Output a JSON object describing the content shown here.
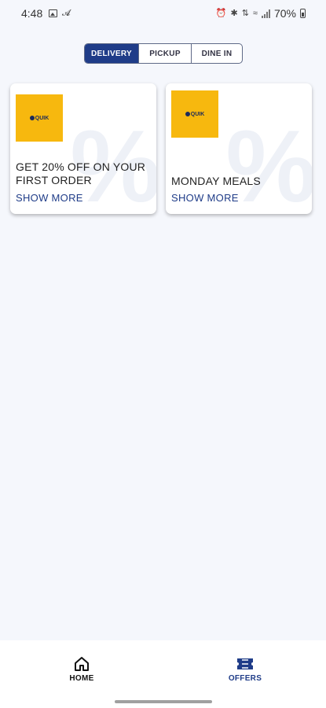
{
  "status_bar": {
    "time": "4:48",
    "battery": "70%",
    "left_icons": [
      "image-icon",
      "signal-badge-icon"
    ],
    "right_icons": [
      "alarm-icon",
      "bluetooth-icon",
      "data-icon",
      "wifi-icon",
      "signal-icon",
      "battery-icon"
    ]
  },
  "tabs": [
    {
      "label": "DELIVERY",
      "selected": true
    },
    {
      "label": "PICKUP",
      "selected": false
    },
    {
      "label": "DINE IN",
      "selected": false
    }
  ],
  "offers": [
    {
      "logo_text": "QUIK",
      "title": "GET 20% OFF ON YOUR FIRST ORDER",
      "more": "SHOW MORE"
    },
    {
      "logo_text": "QUIK",
      "title": "MONDAY MEALS",
      "more": "SHOW MORE"
    }
  ],
  "bottom_nav": {
    "home": {
      "label": "HOME",
      "icon": "home-icon"
    },
    "offers": {
      "label": "OFFERS",
      "icon": "ticket-icon",
      "active": true
    }
  },
  "colors": {
    "accent": "#1f3c88",
    "logo_bg": "#f7b80e",
    "background": "#f5f7fc"
  }
}
